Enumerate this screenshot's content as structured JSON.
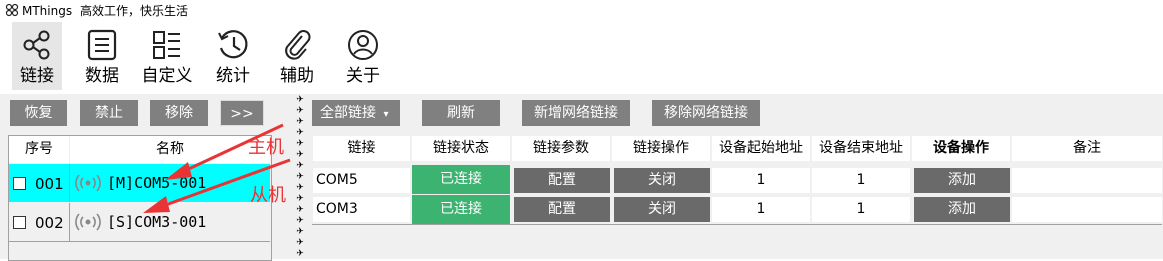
{
  "window": {
    "title": "MThings",
    "slogan": "高效工作，快乐生活"
  },
  "ribbon": [
    {
      "label": "链接",
      "icon": "share-nodes-icon",
      "active": true
    },
    {
      "label": "数据",
      "icon": "list-icon"
    },
    {
      "label": "自定义",
      "icon": "grid-list-icon"
    },
    {
      "label": "统计",
      "icon": "history-clock-icon"
    },
    {
      "label": "辅助",
      "icon": "paperclip-icon"
    },
    {
      "label": "关于",
      "icon": "user-icon"
    }
  ],
  "left_toolbar": {
    "restore": "恢复",
    "disable": "禁止",
    "remove": "移除",
    "expand": ">>"
  },
  "right_toolbar": {
    "filter": "全部链接",
    "refresh": "刷新",
    "add_net": "新增网络链接",
    "remove_net": "移除网络链接"
  },
  "device_table": {
    "headers": {
      "seq": "序号",
      "name": "名称"
    },
    "rows": [
      {
        "seq": "001",
        "name": "[M]COM5-001",
        "selected": true
      },
      {
        "seq": "002",
        "name": "[S]COM3-001",
        "selected": false
      }
    ]
  },
  "link_table": {
    "headers": [
      "链接",
      "链接状态",
      "链接参数",
      "链接操作",
      "设备起始地址",
      "设备结束地址",
      "设备操作",
      "备注"
    ],
    "rows": [
      {
        "link": "COM5",
        "status": "已连接",
        "param": "配置",
        "op": "关闭",
        "start": "1",
        "end": "1",
        "dev_op": "添加",
        "note": ""
      },
      {
        "link": "COM3",
        "status": "已连接",
        "param": "配置",
        "op": "关闭",
        "start": "1",
        "end": "1",
        "dev_op": "添加",
        "note": ""
      }
    ]
  },
  "annotations": {
    "master": "主机",
    "slave": "从机"
  },
  "colors": {
    "status_ok": "#3cb371",
    "selected_row": "#00ffff",
    "annotation": "#e83434",
    "button": "#808080"
  }
}
